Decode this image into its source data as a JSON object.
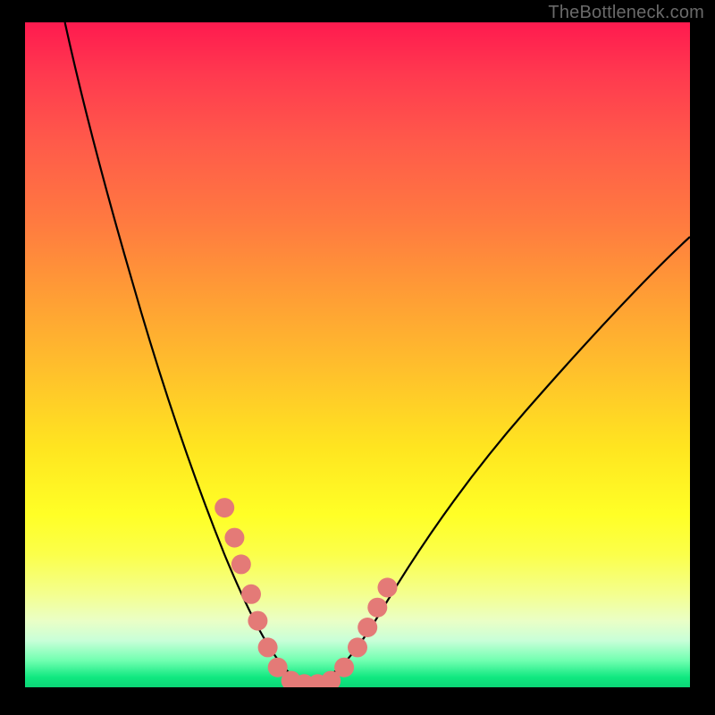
{
  "watermark": "TheBottleneck.com",
  "colors": {
    "frame": "#000000",
    "curve_stroke": "#000000",
    "marker_fill": "#e47a77",
    "gradient_top": "#ff1a4f",
    "gradient_bottom": "#0bd576"
  },
  "chart_data": {
    "type": "line",
    "title": "",
    "xlabel": "",
    "ylabel": "",
    "xlim": [
      0,
      100
    ],
    "ylim": [
      0,
      100
    ],
    "grid": false,
    "legend": false,
    "series": [
      {
        "name": "curve",
        "x": [
          6,
          10,
          14,
          18,
          22,
          26,
          30,
          33,
          35,
          37,
          39,
          41,
          43,
          46,
          49,
          55,
          62,
          70,
          80,
          90,
          100
        ],
        "y": [
          100,
          85,
          72,
          60,
          49,
          38,
          28,
          19,
          13,
          8,
          4,
          1.5,
          0.5,
          0.5,
          3,
          10,
          19,
          28,
          38,
          47,
          55
        ]
      }
    ],
    "markers": [
      {
        "x": 30.0,
        "y": 27.0
      },
      {
        "x": 31.5,
        "y": 22.5
      },
      {
        "x": 32.5,
        "y": 18.5
      },
      {
        "x": 34.0,
        "y": 14.0
      },
      {
        "x": 35.0,
        "y": 10.0
      },
      {
        "x": 36.5,
        "y": 6.0
      },
      {
        "x": 38.0,
        "y": 3.0
      },
      {
        "x": 40.0,
        "y": 1.0
      },
      {
        "x": 42.0,
        "y": 0.5
      },
      {
        "x": 44.0,
        "y": 0.5
      },
      {
        "x": 46.0,
        "y": 1.0
      },
      {
        "x": 48.0,
        "y": 3.0
      },
      {
        "x": 50.0,
        "y": 6.0
      },
      {
        "x": 51.5,
        "y": 9.0
      },
      {
        "x": 53.0,
        "y": 12.0
      },
      {
        "x": 54.5,
        "y": 15.0
      }
    ]
  }
}
